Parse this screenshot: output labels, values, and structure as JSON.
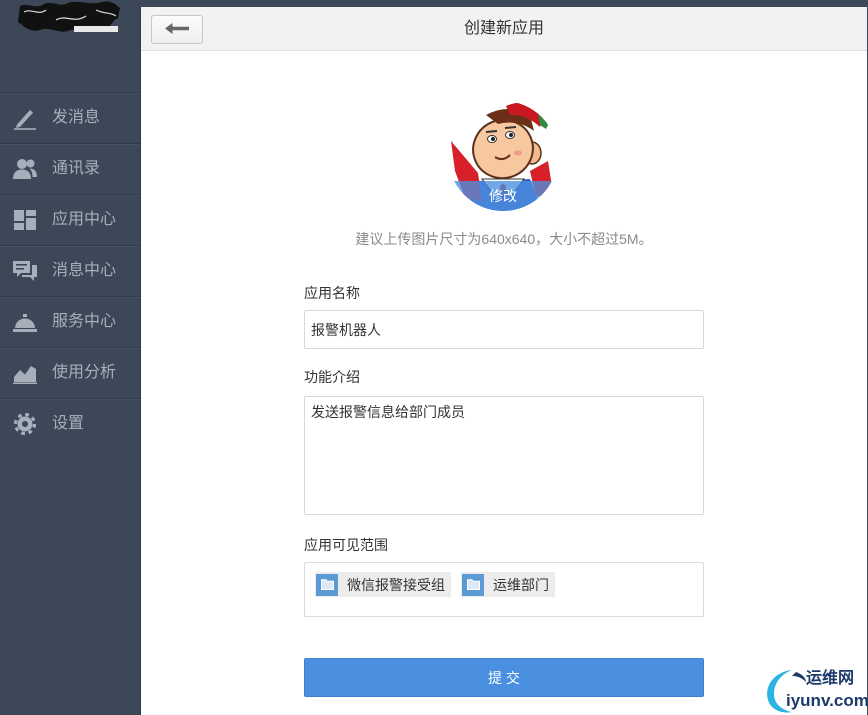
{
  "sidebar": {
    "items": [
      {
        "label": "发消息",
        "icon": "pencil-icon"
      },
      {
        "label": "通讯录",
        "icon": "contacts-icon"
      },
      {
        "label": "应用中心",
        "icon": "app-grid-icon"
      },
      {
        "label": "消息中心",
        "icon": "chat-bubbles-icon"
      },
      {
        "label": "服务中心",
        "icon": "service-bell-icon"
      },
      {
        "label": "使用分析",
        "icon": "line-chart-icon"
      },
      {
        "label": "设置",
        "icon": "gear-icon"
      }
    ]
  },
  "header": {
    "title": "创建新应用",
    "back_icon": "arrow-left-icon"
  },
  "avatar": {
    "edit_label": "修改",
    "hint": "建议上传图片尺寸为640x640，大小不超过5M。"
  },
  "form": {
    "name_label": "应用名称",
    "name_value": "报警机器人",
    "desc_label": "功能介绍",
    "desc_value": "发送报警信息给部门成员",
    "scope_label": "应用可见范围",
    "scope_tags": [
      {
        "label": "微信报警接受组",
        "icon": "folder-icon"
      },
      {
        "label": "运维部门",
        "icon": "folder-icon"
      }
    ],
    "submit_label": "提 交"
  },
  "watermark": {
    "cn": "运维网",
    "domain": "iyunv.com"
  },
  "colors": {
    "sidebar_bg": "#3c4757",
    "sidebar_text": "#a6afba",
    "header_bg": "#f2f2f2",
    "accent": "#4a8fe0",
    "folder_icon": "#5b9bd5",
    "tag_bg": "#ececec"
  }
}
